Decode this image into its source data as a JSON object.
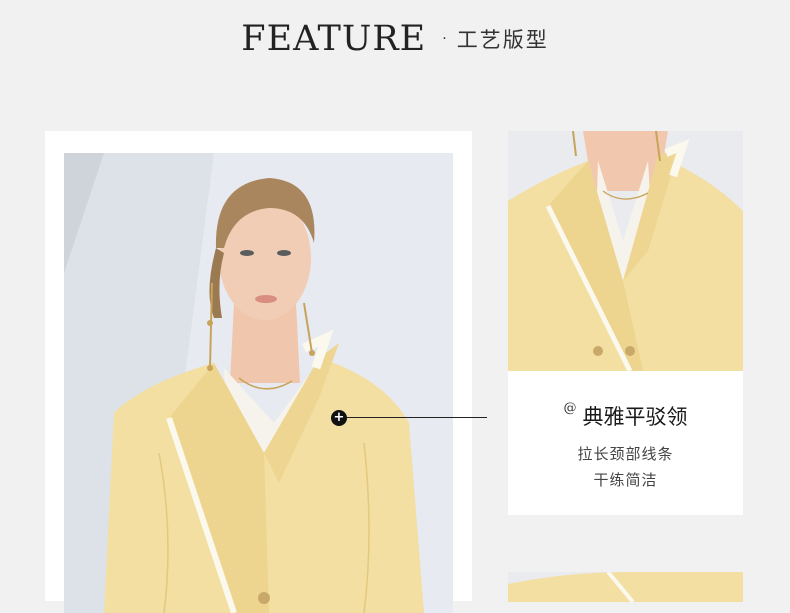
{
  "header": {
    "title": "FEATURE",
    "separator": "·",
    "subtitle": "工艺版型"
  },
  "feature": {
    "at_symbol": "@",
    "title": "典雅平驳领",
    "line1": "拉长颈部线条",
    "line2": "干练简洁"
  },
  "colors": {
    "page_bg": "#f1f1f1",
    "jacket": "#f3dfa2",
    "piping": "#fbf8ee",
    "wall": "#e6e9ef"
  },
  "icons": {
    "hotspot": "plus-circle-icon"
  }
}
